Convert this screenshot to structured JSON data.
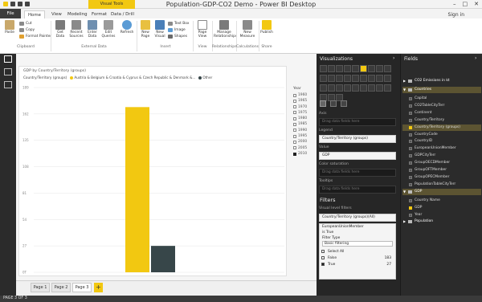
{
  "window": {
    "title": "Population-GDP-CO2 Demo - Power BI Desktop",
    "contextual_tab": "Visual Tools",
    "sign_in": "Sign in"
  },
  "tabs": [
    "File",
    "Home",
    "View",
    "Modeling",
    "Format",
    "Data / Drill"
  ],
  "ribbon": {
    "clipboard": {
      "paste": "Paste",
      "cut": "Cut",
      "copy": "Copy",
      "format_painter": "Format Painter",
      "group": "Clipboard"
    },
    "external_data": {
      "get_data": "Get Data",
      "recent_sources": "Recent Sources",
      "enter_data": "Enter Data",
      "edit_queries": "Edit Queries",
      "refresh": "Refresh",
      "group": "External Data"
    },
    "insert": {
      "new_page": "New Page",
      "new_visual": "New Visual",
      "text_box": "Text Box",
      "image": "Image",
      "shapes": "Shapes",
      "group": "Insert"
    },
    "view": {
      "page_view": "Page View",
      "group": "View"
    },
    "relationships": {
      "manage": "Manage Relationships",
      "group": "Relationships"
    },
    "calculations": {
      "new_measure": "New Measure",
      "group": "Calculations"
    },
    "share": {
      "publish": "Publish",
      "group": "Share"
    }
  },
  "visual": {
    "title": "GDP by Country/Territory (groups)",
    "legend_label": "Country/Territory (groups)",
    "legend_items": [
      {
        "label": "Austria & Belgium & Croatia & Cyprus & Czech Republic & Denmark &...",
        "color": "#f2c811"
      },
      {
        "label": "Other",
        "color": "#374649"
      }
    ]
  },
  "chart_data": {
    "type": "bar",
    "categories": [
      "Austria & Belgium & Croatia & Cyprus & Czech Republic & Denmark &...",
      "Other"
    ],
    "values": [
      169,
      27
    ],
    "yticks": [
      "0T",
      "27",
      "54",
      "81",
      "108",
      "135",
      "162",
      "189"
    ],
    "ylim": [
      0,
      189
    ],
    "colors": [
      "#f2c811",
      "#374649"
    ]
  },
  "slicer": {
    "title": "Year",
    "items": [
      {
        "label": "1960",
        "checked": false
      },
      {
        "label": "1965",
        "checked": false
      },
      {
        "label": "1970",
        "checked": false
      },
      {
        "label": "1975",
        "checked": false
      },
      {
        "label": "1980",
        "checked": false
      },
      {
        "label": "1985",
        "checked": false
      },
      {
        "label": "1990",
        "checked": false
      },
      {
        "label": "1995",
        "checked": false
      },
      {
        "label": "2000",
        "checked": false
      },
      {
        "label": "2005",
        "checked": false
      },
      {
        "label": "2010",
        "checked": true
      }
    ]
  },
  "pages": [
    {
      "label": "Page 1",
      "active": false
    },
    {
      "label": "Page 2",
      "active": false
    },
    {
      "label": "Page 3",
      "active": true
    }
  ],
  "add_page": "+",
  "status": "PAGE 3 OF 3",
  "visualizations": {
    "header": "Visualizations",
    "wells": {
      "axis": "Axis",
      "axis_placeholder": "Drag data fields here",
      "legend": "Legend",
      "legend_value": "Country/Territory (groups)",
      "value": "Value",
      "value_value": "GDP",
      "color_saturation": "Color saturation",
      "color_placeholder": "Drag data fields here",
      "tooltips": "Tooltips",
      "tooltips_placeholder": "Drag data fields here"
    },
    "filters": {
      "header": "Filters",
      "visual_level": "Visual level filters",
      "filter1": "Country/Territory (groups)(All)",
      "filter2_title": "EuropeanUnionMember",
      "filter2_value": "is True",
      "filter_type_label": "Filter Type",
      "filter_type": "Basic filtering",
      "select_all": "Select All",
      "options": [
        {
          "label": "False",
          "count": "183",
          "checked": false
        },
        {
          "label": "True",
          "count": "27",
          "checked": true
        }
      ]
    }
  },
  "fields": {
    "header": "Fields",
    "items": [
      {
        "label": "CO2 Emissions in kt",
        "type": "table",
        "expanded": false,
        "checked": false,
        "highlight": false
      },
      {
        "label": "Countries",
        "type": "table",
        "expanded": true,
        "checked": false,
        "highlight": true
      },
      {
        "label": "Capital",
        "type": "field",
        "checked": false,
        "highlight": false
      },
      {
        "label": "CO2TableCityTerr",
        "type": "field",
        "checked": false,
        "highlight": false
      },
      {
        "label": "Continent",
        "type": "field",
        "checked": false,
        "highlight": false
      },
      {
        "label": "Country/Territory",
        "type": "field",
        "checked": false,
        "highlight": false
      },
      {
        "label": "Country/Territory (groups)",
        "type": "field",
        "checked": true,
        "highlight": true
      },
      {
        "label": "CountryCode",
        "type": "field",
        "checked": false,
        "highlight": false
      },
      {
        "label": "CountryID",
        "type": "field",
        "checked": false,
        "highlight": false
      },
      {
        "label": "EuropeanUnionMember",
        "type": "field",
        "checked": false,
        "highlight": false
      },
      {
        "label": "GDPCityTerr",
        "type": "field",
        "checked": false,
        "highlight": false
      },
      {
        "label": "GroupOECDMember",
        "type": "field",
        "checked": false,
        "highlight": false
      },
      {
        "label": "GroupOFTMember",
        "type": "field",
        "checked": false,
        "highlight": false
      },
      {
        "label": "GroupOPECMember",
        "type": "field",
        "checked": false,
        "highlight": false
      },
      {
        "label": "PopulationTableCityTerr",
        "type": "field",
        "checked": false,
        "highlight": false
      },
      {
        "label": "GDP",
        "type": "table",
        "expanded": true,
        "checked": false,
        "highlight": true
      },
      {
        "label": "Country Name",
        "type": "field",
        "checked": false,
        "highlight": false
      },
      {
        "label": "GDP",
        "type": "field",
        "checked": true,
        "highlight": false
      },
      {
        "label": "Year",
        "type": "field",
        "checked": false,
        "highlight": false
      },
      {
        "label": "Population",
        "type": "table",
        "expanded": false,
        "checked": false,
        "highlight": false
      }
    ]
  }
}
